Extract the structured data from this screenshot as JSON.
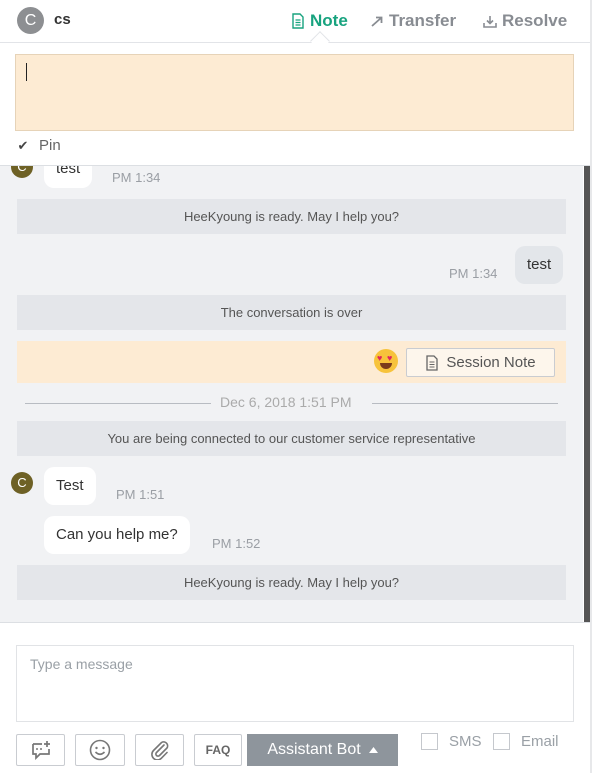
{
  "header": {
    "avatar_initial": "C",
    "customer_name": "cs",
    "actions": {
      "note": "Note",
      "transfer": "Transfer",
      "resolve": "Resolve"
    },
    "accent_color": "#18a37f"
  },
  "note": {
    "value": "",
    "pin_label": "Pin",
    "pin_checked": true
  },
  "conversation": {
    "msg1": {
      "avatar": "C",
      "text": "test",
      "time": "PM 1:34"
    },
    "sys1": "HeeKyoung is ready. May I help you?",
    "msg2": {
      "text": "test",
      "time": "PM 1:34"
    },
    "sys2": "The conversation is over",
    "session_note_label": "Session Note",
    "date_separator": "Dec 6, 2018 1:51 PM",
    "sys3": "You are being connected to our customer service representative",
    "msg3": {
      "avatar": "C",
      "text": "Test",
      "time": "PM 1:51"
    },
    "msg4": {
      "text": "Can you help me?",
      "time": "PM 1:52"
    },
    "sys4": "HeeKyoung is ready. May I help you?"
  },
  "compose": {
    "placeholder": "Type a message",
    "faq_label": "FAQ",
    "assistant_bot_label": "Assistant Bot",
    "sms_label": "SMS",
    "email_label": "Email"
  }
}
